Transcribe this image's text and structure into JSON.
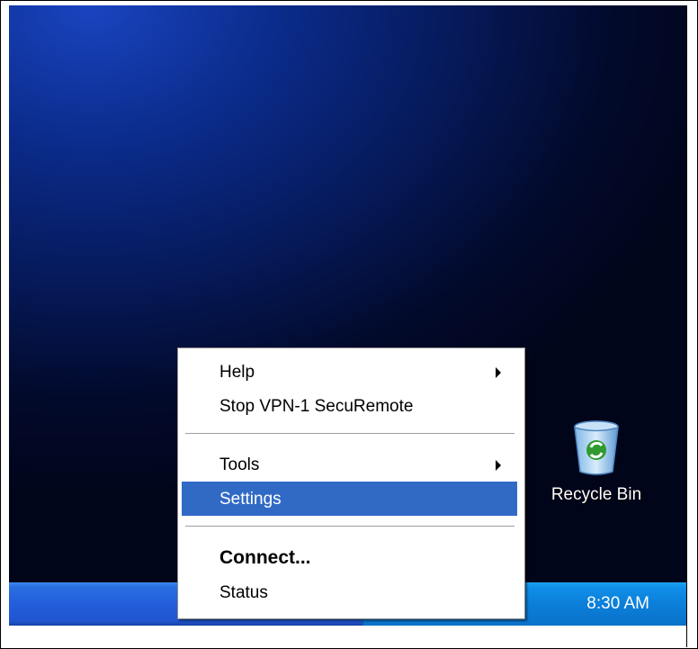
{
  "context_menu": {
    "items": [
      {
        "label": "Help",
        "submenu": true
      },
      {
        "label": "Stop VPN-1 SecuRemote"
      },
      {
        "label": "Tools",
        "submenu": true
      },
      {
        "label": "Settings",
        "selected": true
      },
      {
        "label": "Connect...",
        "bold": true
      },
      {
        "label": "Status"
      }
    ]
  },
  "desktop": {
    "recycle_bin_label": "Recycle Bin"
  },
  "taskbar": {
    "clock": "8:30 AM",
    "tray_icons": [
      "network-icon",
      "securemote-icon",
      "app-icon",
      "shield-icon",
      "alert-icon"
    ]
  },
  "colors": {
    "selection": "#316ac5",
    "taskbar": "#245edb",
    "tray": "#0b7fd9"
  }
}
